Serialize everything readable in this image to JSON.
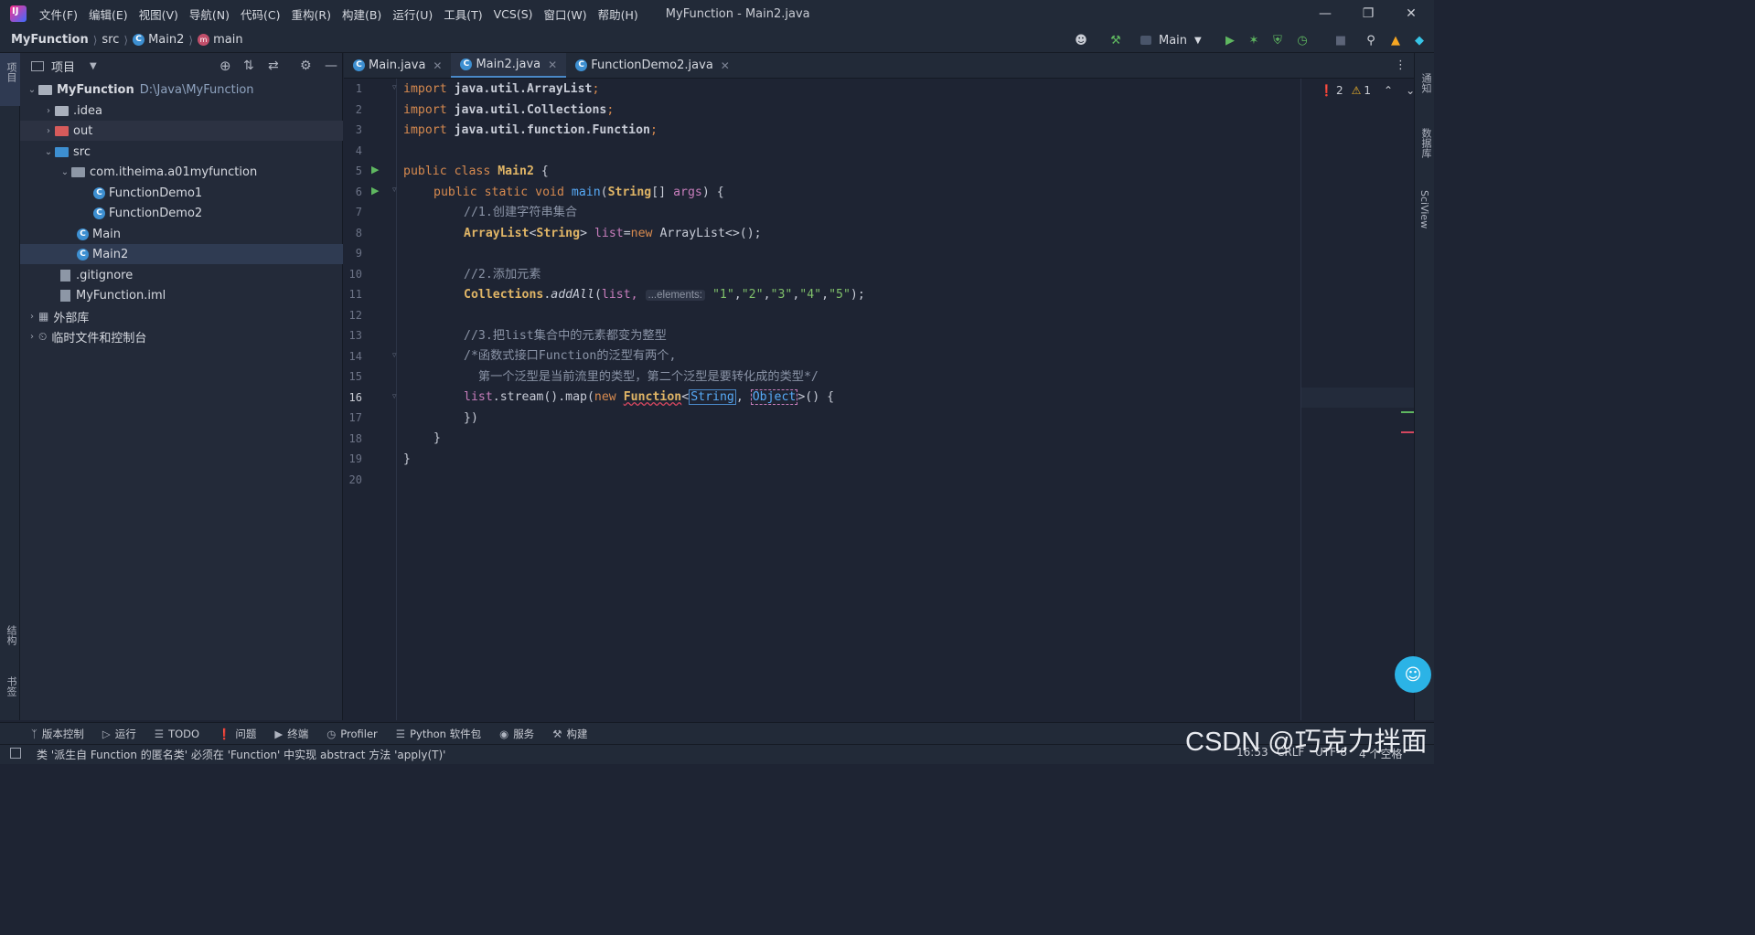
{
  "menu": [
    "文件(F)",
    "编辑(E)",
    "视图(V)",
    "导航(N)",
    "代码(C)",
    "重构(R)",
    "构建(B)",
    "运行(U)",
    "工具(T)",
    "VCS(S)",
    "窗口(W)",
    "帮助(H)"
  ],
  "window_title": "MyFunction - Main2.java",
  "breadcrumb": {
    "project": "MyFunction",
    "src": "src",
    "cls": "Main2",
    "method": "main"
  },
  "run_config": "Main",
  "project_panel": {
    "title": "项目",
    "tree": {
      "root_name": "MyFunction",
      "root_path": "D:\\Java\\MyFunction",
      "idea": ".idea",
      "out": "out",
      "src": "src",
      "package": "com.itheima.a01myfunction",
      "fd1": "FunctionDemo1",
      "fd2": "FunctionDemo2",
      "main": "Main",
      "main2": "Main2",
      "gitignore": ".gitignore",
      "iml": "MyFunction.iml",
      "ext_libs": "外部库",
      "scratches": "临时文件和控制台"
    }
  },
  "tabs": [
    {
      "label": "Main.java"
    },
    {
      "label": "Main2.java"
    },
    {
      "label": "FunctionDemo2.java"
    }
  ],
  "inspection": {
    "errors": "2",
    "warnings": "1"
  },
  "line_numbers": [
    "1",
    "2",
    "3",
    "4",
    "5",
    "6",
    "7",
    "8",
    "9",
    "10",
    "11",
    "12",
    "13",
    "14",
    "15",
    "16",
    "17",
    "18",
    "19",
    "20"
  ],
  "code": {
    "l1_kw": "import",
    "l1_rest": "java.util.ArrayList",
    "l2_kw": "import",
    "l2_rest": "java.util.Collections",
    "l3_kw": "import",
    "l3_rest": "java.util.function.Function",
    "l5_kw": "public class",
    "l5_cls": "Main2",
    "l6_kw": "public static void",
    "l6_fn": "main",
    "l6_type": "String",
    "l6_param": "args",
    "l7": "//1.创建字符串集合",
    "l8_type": "ArrayList",
    "l8_gen": "String",
    "l8_var": "list",
    "l8_new": "new",
    "l8_rest": "ArrayList<>();",
    "l10": "//2.添加元素",
    "l11_cls": "Collections",
    "l11_fn": "addAll",
    "l11_var": "list,",
    "l11_hint": "...elements:",
    "l11_strs": [
      "\"1\"",
      "\"2\"",
      "\"3\"",
      "\"4\"",
      "\"5\""
    ],
    "l13": "//3.把list集合中的元素都变为整型",
    "l14": "/*函数式接口Function的泛型有两个,",
    "l15": "  第一个泛型是当前流里的类型，第二个泛型是要转化成的类型*/",
    "l16_var": "list",
    "l16_mid": ".stream().map(",
    "l16_new": "new",
    "l16_cls": "Function",
    "l16_t1": "String",
    "l16_t2": "Object",
    "l16_end": ">() {",
    "l17": "})",
    "l18": "}",
    "l19": "}"
  },
  "bottom_tools": [
    "版本控制",
    "运行",
    "TODO",
    "问题",
    "终端",
    "Profiler",
    "Python 软件包",
    "服务",
    "构建"
  ],
  "status": {
    "message": "类 '派生自 Function 的匿名类' 必须在 'Function' 中实现 abstract 方法 'apply(T)'",
    "position": "16:53",
    "line_sep": "CRLF",
    "encoding": "UTF-8",
    "indent": "4 个空格"
  },
  "left_strip": {
    "project": "项目",
    "structure": "结构",
    "bookmarks": "书签"
  },
  "right_strip": {
    "notifications": "通知",
    "database": "数据库",
    "sciview": "SciView"
  },
  "watermark": "CSDN @巧克力拌面"
}
